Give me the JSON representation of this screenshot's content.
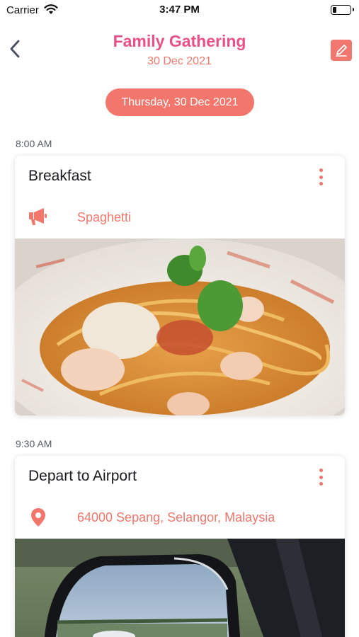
{
  "status_bar": {
    "carrier": "Carrier",
    "time": "3:47 PM"
  },
  "nav": {
    "title": "Family Gathering",
    "subtitle": "30 Dec 2021",
    "back_icon": "chevron-left-icon",
    "edit_icon": "edit-icon"
  },
  "date_pill": "Thursday, 30 Dec 2021",
  "events": [
    {
      "time": "8:00 AM",
      "title": "Breakfast",
      "icon": "megaphone-icon",
      "detail": "Spaghetti",
      "image": "spaghetti-photo"
    },
    {
      "time": "9:30 AM",
      "title": "Depart to Airport",
      "icon": "location-pin-icon",
      "detail": "64000 Sepang, Selangor, Malaysia",
      "image": "car-mirror-photo"
    }
  ],
  "colors": {
    "accent": "#f2766b",
    "title_pink": "#ec4f86",
    "pill": "#f2766b"
  }
}
